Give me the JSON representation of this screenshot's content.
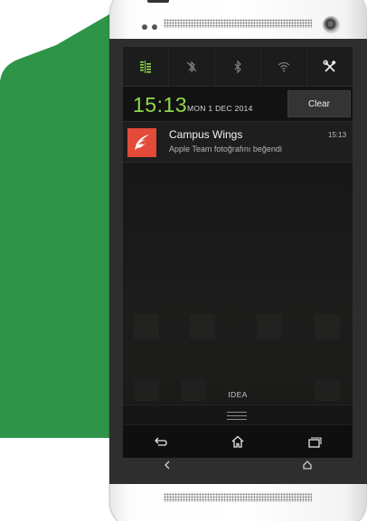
{
  "colors": {
    "green_background": "#2e9447",
    "clock_green": "#8fd94a",
    "notification_icon_red": "#e24a3a"
  },
  "quick_settings": [
    {
      "icon": "data-transfer-icon",
      "active": true
    },
    {
      "icon": "bluetooth-off-icon",
      "active": false
    },
    {
      "icon": "bluetooth-icon",
      "active": false
    },
    {
      "icon": "wifi-icon",
      "active": false
    },
    {
      "icon": "tools-icon",
      "active": true
    }
  ],
  "status": {
    "time": "15:13",
    "date": "MON 1 DEC 2014",
    "clear_label": "Clear"
  },
  "notification": {
    "app_name": "Campus Wings",
    "message": "Apple Team fotoğrafını beğendi",
    "time": "15:13",
    "icon": "wings-icon"
  },
  "home": {
    "label": "IDEA"
  },
  "navbar": [
    {
      "icon": "back-icon"
    },
    {
      "icon": "home-icon"
    },
    {
      "icon": "recent-apps-icon"
    }
  ],
  "hardware_buttons": [
    {
      "icon": "back-chevron-icon"
    },
    {
      "icon": "home-house-icon"
    }
  ]
}
